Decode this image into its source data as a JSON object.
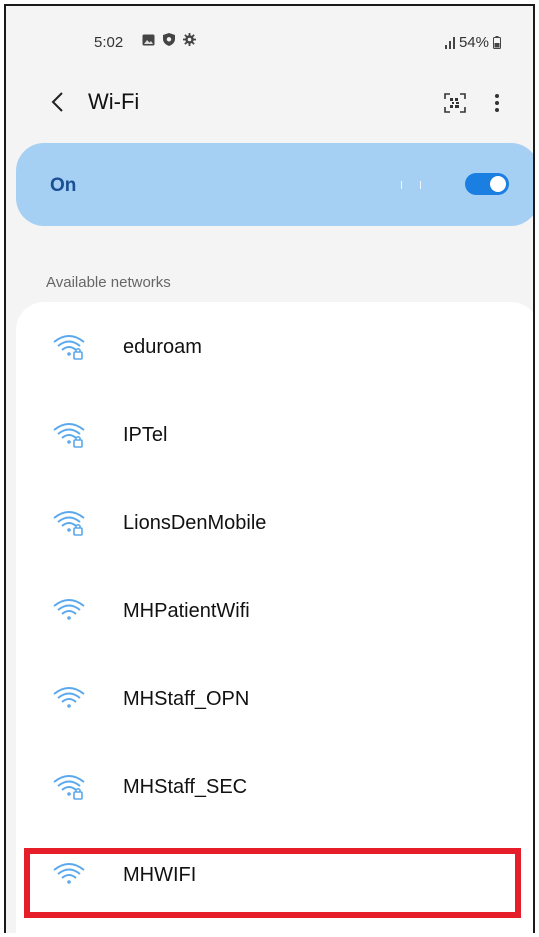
{
  "status_bar": {
    "time": "5:02",
    "left_icons": [
      "image-icon",
      "shield-icon",
      "gear-icon"
    ],
    "signal_icon": "signal-icon",
    "battery_text": "54%",
    "battery_icon": "battery-icon"
  },
  "app_bar": {
    "back_icon": "chevron-left-icon",
    "title": "Wi-Fi",
    "qr_icon": "qr-scan-icon",
    "more_icon": "more-vertical-icon"
  },
  "wifi_toggle": {
    "label": "On",
    "state": "on",
    "accent_color": "#1a7fe0",
    "card_color": "#a6d0f3"
  },
  "available_networks": {
    "header": "Available networks",
    "items": [
      {
        "name": "eduroam",
        "icon": "wifi-lock-icon",
        "secured": true
      },
      {
        "name": "IPTel",
        "icon": "wifi-lock-icon",
        "secured": true
      },
      {
        "name": "LionsDenMobile",
        "icon": "wifi-lock-icon",
        "secured": true
      },
      {
        "name": "MHPatientWifi",
        "icon": "wifi-icon",
        "secured": false
      },
      {
        "name": "MHStaff_OPN",
        "icon": "wifi-icon",
        "secured": false
      },
      {
        "name": "MHStaff_SEC",
        "icon": "wifi-lock-icon",
        "secured": true
      },
      {
        "name": "MHWIFI",
        "icon": "wifi-icon",
        "secured": false
      }
    ]
  },
  "highlight": {
    "target": "MHWIFI",
    "color": "#e61e2a"
  }
}
